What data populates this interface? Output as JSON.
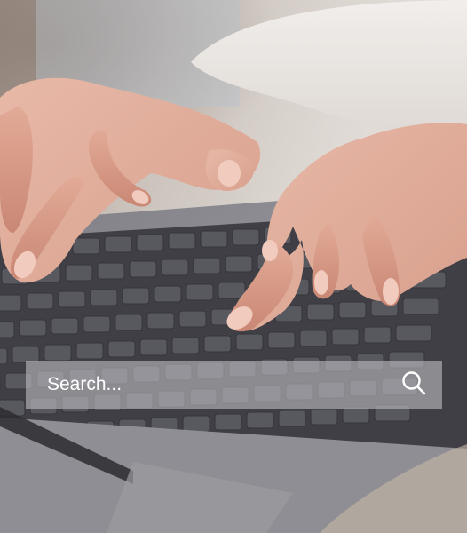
{
  "search": {
    "placeholder": "Search...",
    "icon": "search-icon"
  },
  "photo": {
    "subject": "hands-typing-on-laptop-keyboard"
  },
  "colors": {
    "search_bar_bg": "#b9b9be",
    "search_text": "#ffffff",
    "keyboard": "#4c4c52",
    "laptop_body": "#8d8d93"
  }
}
